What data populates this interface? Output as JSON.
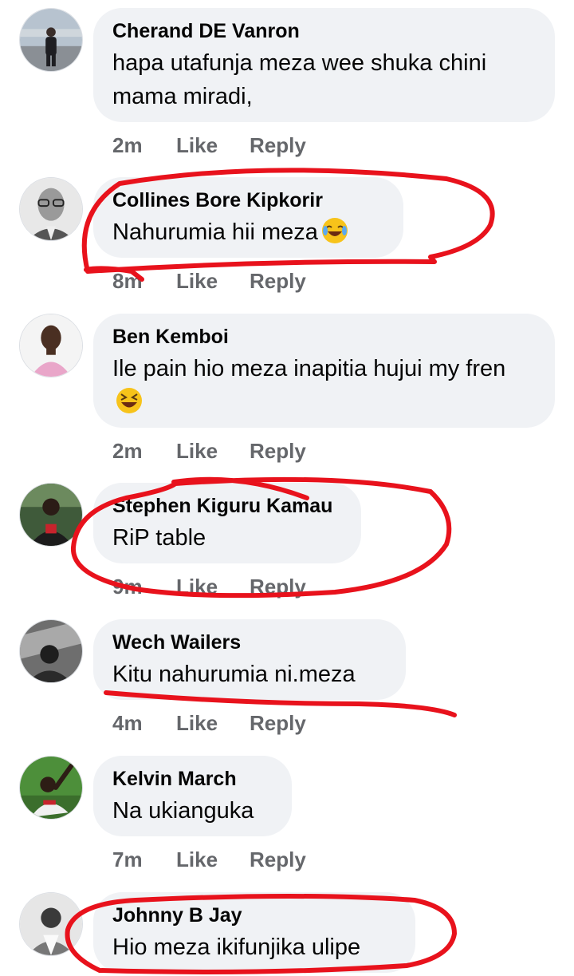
{
  "comments": [
    {
      "author": "Cherand DE Vanron",
      "text": "hapa utafunja meza wee shuka chini mama miradi,",
      "time": "2m",
      "like": "Like",
      "reply": "Reply",
      "avatar": "avatar-photo"
    },
    {
      "author": "Collines Bore Kipkorir",
      "text": "Nahurumia hii meza",
      "emoji": "joy-emoji",
      "time": "8m",
      "like": "Like",
      "reply": "Reply",
      "avatar": "avatar-sketch"
    },
    {
      "author": "Ben Kemboi",
      "text": "Ile pain hio meza inapitia hujui my fren",
      "emoji": "laughing-emoji",
      "time": "2m",
      "like": "Like",
      "reply": "Reply",
      "avatar": "avatar-photo"
    },
    {
      "author": "Stephen Kiguru Kamau",
      "text": "RiP table",
      "time": "9m",
      "like": "Like",
      "reply": "Reply",
      "avatar": "avatar-photo"
    },
    {
      "author": "Wech Wailers",
      "text": "Kitu nahurumia ni.meza",
      "time": "4m",
      "like": "Like",
      "reply": "Reply",
      "avatar": "avatar-photo"
    },
    {
      "author": "Kelvin March",
      "text": "Na ukianguka",
      "time": "7m",
      "like": "Like",
      "reply": "Reply",
      "avatar": "avatar-photo"
    },
    {
      "author": "Johnny B Jay",
      "text": "Hio meza ikifunjika ulipe",
      "avatar": "avatar-photo"
    }
  ],
  "colors": {
    "bubble": "#f0f2f5",
    "author": "#050505",
    "meta": "#65676b",
    "annotation_marker": "#e8121c"
  }
}
